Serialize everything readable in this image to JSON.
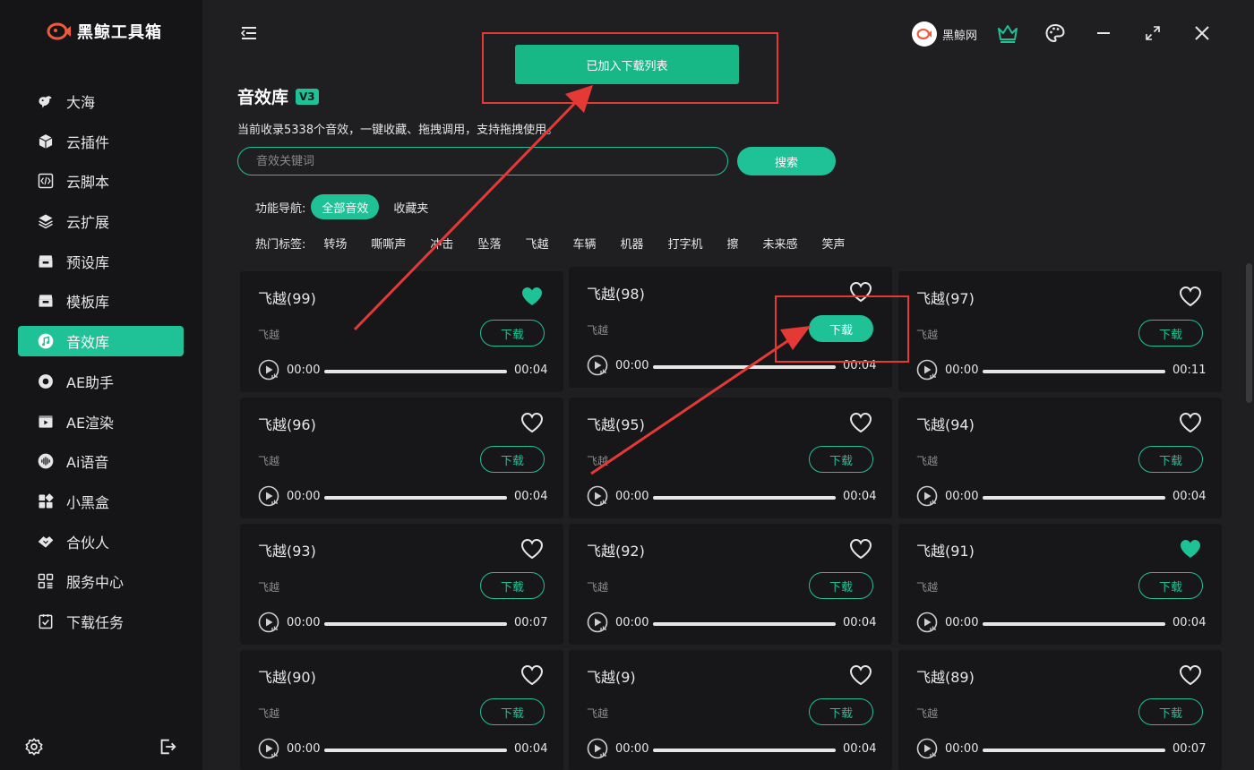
{
  "app": {
    "name": "黑鲸工具箱"
  },
  "sidebar": {
    "items": [
      {
        "label": "大海",
        "icon": "whale-icon"
      },
      {
        "label": "云插件",
        "icon": "cube-icon"
      },
      {
        "label": "云脚本",
        "icon": "code-file-icon"
      },
      {
        "label": "云扩展",
        "icon": "layers-icon"
      },
      {
        "label": "预设库",
        "icon": "archive-box-icon"
      },
      {
        "label": "模板库",
        "icon": "archive-box-icon"
      },
      {
        "label": "音效库",
        "icon": "music-note-icon",
        "active": true
      },
      {
        "label": "AE助手",
        "icon": "ae-gear-icon"
      },
      {
        "label": "AE渲染",
        "icon": "render-play-icon"
      },
      {
        "label": "Ai语音",
        "icon": "voice-wave-icon"
      },
      {
        "label": "小黑盒",
        "icon": "grid-boxes-icon"
      },
      {
        "label": "合伙人",
        "icon": "handshake-icon"
      },
      {
        "label": "服务中心",
        "icon": "service-grid-icon"
      },
      {
        "label": "下载任务",
        "icon": "download-task-icon"
      }
    ]
  },
  "topbar": {
    "toast": "已加入下载列表",
    "brand_name": "黑鲸网"
  },
  "header": {
    "title": "音效库",
    "version": "V3",
    "subtitle": "当前收录5338个音效，一键收藏、拖拽调用，支持拖拽使用。"
  },
  "search": {
    "placeholder": "音效关键词",
    "button": "搜索"
  },
  "func_nav": {
    "label": "功能导航:",
    "items": [
      "全部音效",
      "收藏夹"
    ]
  },
  "hot_tags": {
    "label": "热门标签:",
    "items": [
      "转场",
      "嘶嘶声",
      "冲击",
      "坠落",
      "飞越",
      "车辆",
      "机器",
      "打字机",
      "擦",
      "未来感",
      "笑声"
    ]
  },
  "cards": [
    {
      "title": "飞越(99)",
      "category": "飞越",
      "download": "下载",
      "start": "00:00",
      "duration": "00:04",
      "favorited": true
    },
    {
      "title": "飞越(98)",
      "category": "飞越",
      "download": "下载",
      "start": "00:00",
      "duration": "00:04",
      "favorited": false,
      "hovered": true
    },
    {
      "title": "飞越(97)",
      "category": "飞越",
      "download": "下载",
      "start": "00:00",
      "duration": "00:11",
      "favorited": false
    },
    {
      "title": "飞越(96)",
      "category": "飞越",
      "download": "下载",
      "start": "00:00",
      "duration": "00:04",
      "favorited": false
    },
    {
      "title": "飞越(95)",
      "category": "飞越",
      "download": "下载",
      "start": "00:00",
      "duration": "00:04",
      "favorited": false
    },
    {
      "title": "飞越(94)",
      "category": "飞越",
      "download": "下载",
      "start": "00:00",
      "duration": "00:04",
      "favorited": false
    },
    {
      "title": "飞越(93)",
      "category": "飞越",
      "download": "下载",
      "start": "00:00",
      "duration": "00:07",
      "favorited": false
    },
    {
      "title": "飞越(92)",
      "category": "飞越",
      "download": "下载",
      "start": "00:00",
      "duration": "00:04",
      "favorited": false
    },
    {
      "title": "飞越(91)",
      "category": "飞越",
      "download": "下载",
      "start": "00:00",
      "duration": "00:04",
      "favorited": true
    },
    {
      "title": "飞越(90)",
      "category": "飞越",
      "download": "下载",
      "start": "00:00",
      "duration": "00:04",
      "favorited": false
    },
    {
      "title": "飞越(9)",
      "category": "飞越",
      "download": "下载",
      "start": "00:00",
      "duration": "00:04",
      "favorited": false
    },
    {
      "title": "飞越(89)",
      "category": "飞越",
      "download": "下载",
      "start": "00:00",
      "duration": "00:07",
      "favorited": false
    }
  ],
  "colors": {
    "accent": "#1fc196",
    "sidebar_bg": "#151517",
    "main_bg": "#1f1f22",
    "card_bg": "#171719",
    "annotation": "#e53935"
  }
}
